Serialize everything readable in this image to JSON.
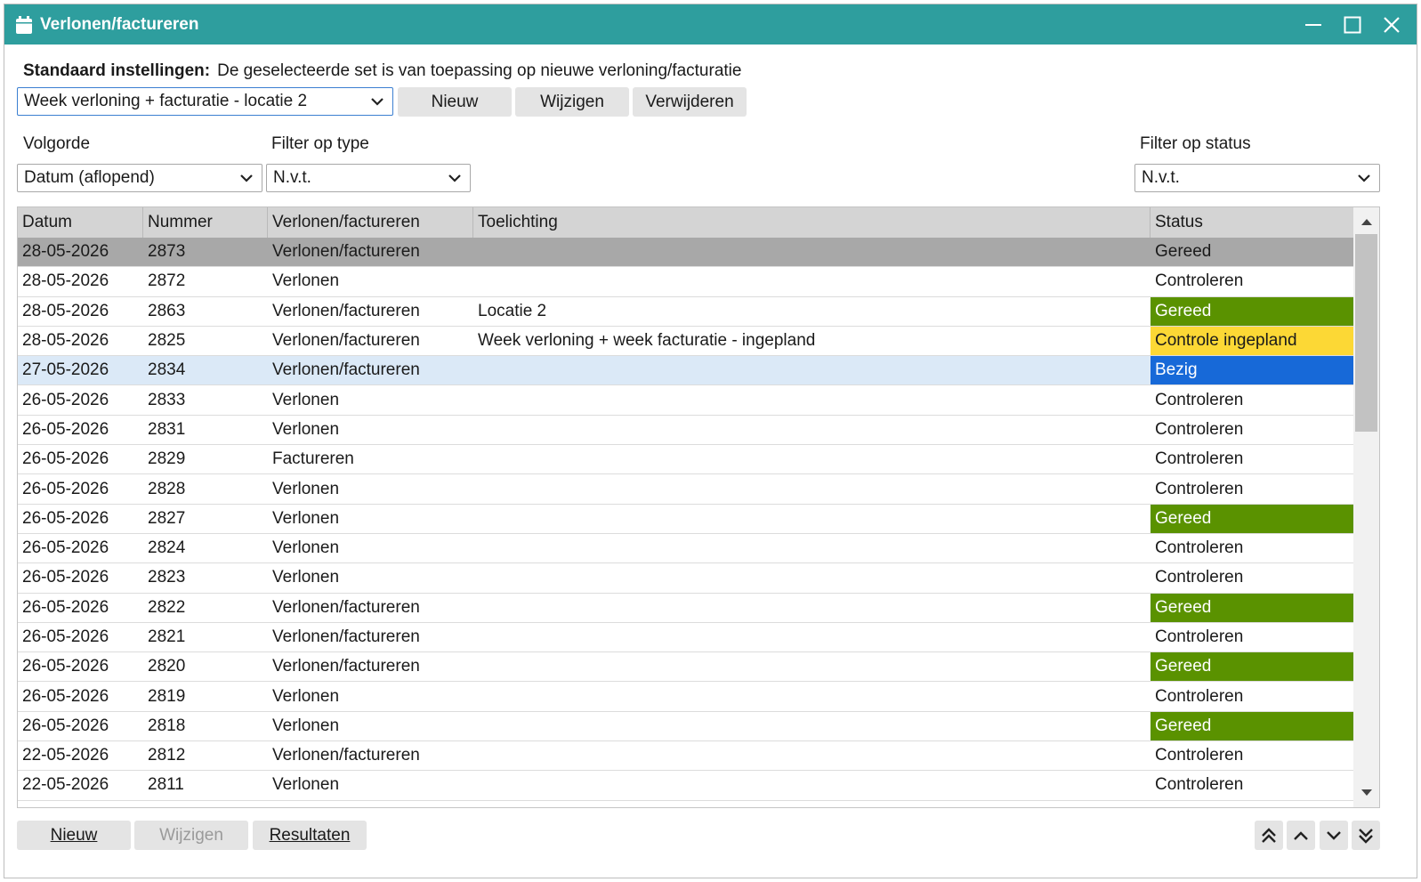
{
  "window": {
    "title": "Verlonen/factureren",
    "icon": "calendar-icon",
    "controls": [
      "minimize-icon",
      "maximize-icon",
      "close-icon"
    ]
  },
  "settings": {
    "label": "Standaard instellingen:",
    "description": "De geselecteerde set is van toepassing op nieuwe verloning/facturatie",
    "selected_set": "Week verloning + facturatie - locatie 2",
    "new_label": "Nieuw",
    "edit_label": "Wijzigen",
    "delete_label": "Verwijderen"
  },
  "filters": {
    "order_label": "Volgorde",
    "order_value": "Datum (aflopend)",
    "type_label": "Filter op type",
    "type_value": "N.v.t.",
    "status_label": "Filter op status",
    "status_value": "N.v.t."
  },
  "table": {
    "columns": [
      "Datum",
      "Nummer",
      "Verlonen/factureren",
      "Toelichting",
      "Status"
    ],
    "rows": [
      {
        "datum": "28-05-2026",
        "nummer": "2873",
        "type": "Verlonen/factureren",
        "toelichting": "",
        "status": "Gereed",
        "status_style": "plain",
        "row_style": "sel-grey"
      },
      {
        "datum": "28-05-2026",
        "nummer": "2872",
        "type": "Verlonen",
        "toelichting": "",
        "status": "Controleren",
        "status_style": "plain",
        "row_style": ""
      },
      {
        "datum": "28-05-2026",
        "nummer": "2863",
        "type": "Verlonen/factureren",
        "toelichting": "Locatie 2",
        "status": "Gereed",
        "status_style": "green",
        "row_style": ""
      },
      {
        "datum": "28-05-2026",
        "nummer": "2825",
        "type": "Verlonen/factureren",
        "toelichting": "Week verloning + week facturatie - ingepland",
        "status": "Controle ingepland",
        "status_style": "yellow",
        "row_style": ""
      },
      {
        "datum": "27-05-2026",
        "nummer": "2834",
        "type": "Verlonen/factureren",
        "toelichting": "",
        "status": "Bezig",
        "status_style": "blue",
        "row_style": "sel-blue"
      },
      {
        "datum": "26-05-2026",
        "nummer": "2833",
        "type": "Verlonen",
        "toelichting": "",
        "status": "Controleren",
        "status_style": "plain",
        "row_style": ""
      },
      {
        "datum": "26-05-2026",
        "nummer": "2831",
        "type": "Verlonen",
        "toelichting": "",
        "status": "Controleren",
        "status_style": "plain",
        "row_style": ""
      },
      {
        "datum": "26-05-2026",
        "nummer": "2829",
        "type": "Factureren",
        "toelichting": "",
        "status": "Controleren",
        "status_style": "plain",
        "row_style": ""
      },
      {
        "datum": "26-05-2026",
        "nummer": "2828",
        "type": "Verlonen",
        "toelichting": "",
        "status": "Controleren",
        "status_style": "plain",
        "row_style": ""
      },
      {
        "datum": "26-05-2026",
        "nummer": "2827",
        "type": "Verlonen",
        "toelichting": "",
        "status": "Gereed",
        "status_style": "green",
        "row_style": ""
      },
      {
        "datum": "26-05-2026",
        "nummer": "2824",
        "type": "Verlonen",
        "toelichting": "",
        "status": "Controleren",
        "status_style": "plain",
        "row_style": ""
      },
      {
        "datum": "26-05-2026",
        "nummer": "2823",
        "type": "Verlonen",
        "toelichting": "",
        "status": "Controleren",
        "status_style": "plain",
        "row_style": ""
      },
      {
        "datum": "26-05-2026",
        "nummer": "2822",
        "type": "Verlonen/factureren",
        "toelichting": "",
        "status": "Gereed",
        "status_style": "green",
        "row_style": ""
      },
      {
        "datum": "26-05-2026",
        "nummer": "2821",
        "type": "Verlonen/factureren",
        "toelichting": "",
        "status": "Controleren",
        "status_style": "plain",
        "row_style": ""
      },
      {
        "datum": "26-05-2026",
        "nummer": "2820",
        "type": "Verlonen/factureren",
        "toelichting": "",
        "status": "Gereed",
        "status_style": "green",
        "row_style": ""
      },
      {
        "datum": "26-05-2026",
        "nummer": "2819",
        "type": "Verlonen",
        "toelichting": "",
        "status": "Controleren",
        "status_style": "plain",
        "row_style": ""
      },
      {
        "datum": "26-05-2026",
        "nummer": "2818",
        "type": "Verlonen",
        "toelichting": "",
        "status": "Gereed",
        "status_style": "green",
        "row_style": ""
      },
      {
        "datum": "22-05-2026",
        "nummer": "2812",
        "type": "Verlonen/factureren",
        "toelichting": "",
        "status": "Controleren",
        "status_style": "plain",
        "row_style": ""
      },
      {
        "datum": "22-05-2026",
        "nummer": "2811",
        "type": "Verlonen",
        "toelichting": "",
        "status": "Controleren",
        "status_style": "plain",
        "row_style": ""
      }
    ]
  },
  "footer": {
    "new_label": "Nieuw",
    "edit_label": "Wijzigen",
    "results_label": "Resultaten",
    "nav_icons": [
      "double-chevron-up-icon",
      "chevron-up-icon",
      "chevron-down-icon",
      "double-chevron-down-icon"
    ]
  },
  "colors": {
    "titlebar": "#2e9e9e",
    "status_green": "#5a9200",
    "status_yellow": "#fcd835",
    "status_blue": "#1769d8",
    "selected_row": "#a8a8a8",
    "active_row": "#dbe9f7"
  }
}
